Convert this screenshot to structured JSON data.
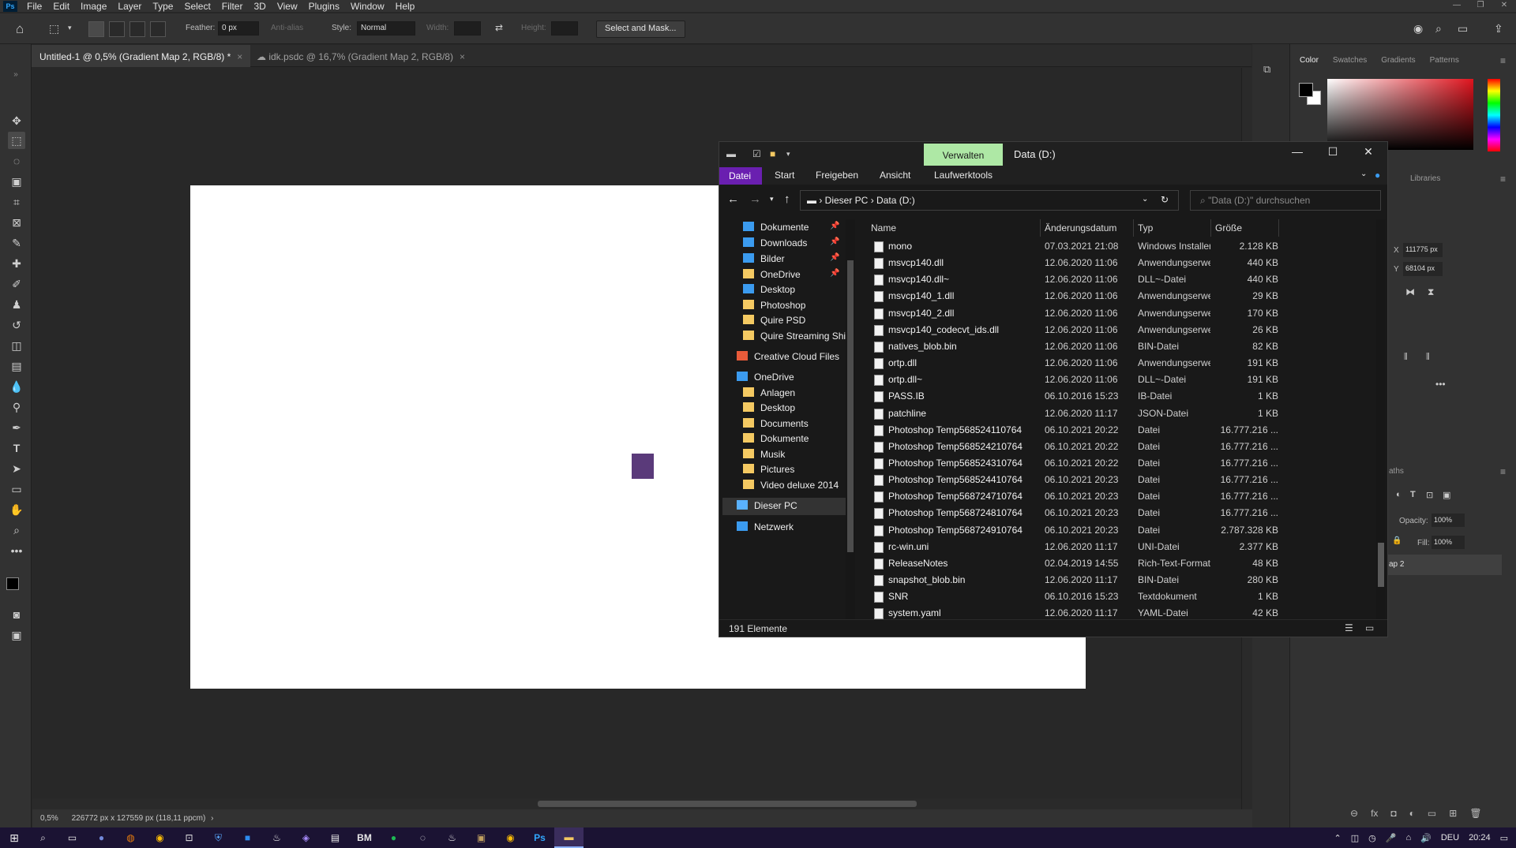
{
  "ps": {
    "menu": [
      "File",
      "Edit",
      "Image",
      "Layer",
      "Type",
      "Select",
      "Filter",
      "3D",
      "View",
      "Plugins",
      "Window",
      "Help"
    ],
    "logo": "Ps",
    "options": {
      "feather_label": "Feather:",
      "feather_value": "0 px",
      "antialias": "Anti-alias",
      "style_label": "Style:",
      "style_value": "Normal",
      "width_label": "Width:",
      "height_label": "Height:",
      "select_mask": "Select and Mask..."
    },
    "tabs": [
      {
        "label": "Untitled-1 @ 0,5% (Gradient Map 2, RGB/8) *"
      },
      {
        "label": "idk.psdc @ 16,7% (Gradient Map 2, RGB/8)"
      }
    ],
    "status": {
      "zoom": "0,5%",
      "doc_size": "226772 px x 127559 px (118,11 ppcm)"
    },
    "panels": {
      "color_tabs": [
        "Color",
        "Swatches",
        "Gradients",
        "Patterns"
      ],
      "libraries_tab": "Libraries",
      "x_label": "X",
      "x_value": "111775 px",
      "y_label": "Y",
      "y_value": "68104 px",
      "opacity_label": "Opacity:",
      "opacity_value": "100%",
      "fill_label": "Fill:",
      "fill_value": "100%",
      "layer_name": "ap 2",
      "paths_tab": "aths"
    }
  },
  "explorer": {
    "manage_tab": "Verwalten",
    "window_title": "Data (D:)",
    "ribbon": [
      "Datei",
      "Start",
      "Freigeben",
      "Ansicht",
      "Laufwerktools"
    ],
    "breadcrumb": [
      "Dieser PC",
      "Data (D:)"
    ],
    "search_placeholder": "\"Data (D:)\" durchsuchen",
    "nav": [
      {
        "label": "Dokumente",
        "pinned": true
      },
      {
        "label": "Downloads",
        "pinned": true
      },
      {
        "label": "Bilder",
        "pinned": true
      },
      {
        "label": "OneDrive",
        "pinned": true
      },
      {
        "label": "Desktop"
      },
      {
        "label": "Photoshop"
      },
      {
        "label": "Quire PSD"
      },
      {
        "label": "Quire Streaming Shi"
      },
      {
        "label": "Creative Cloud Files"
      },
      {
        "label": "OneDrive"
      },
      {
        "label": "Anlagen"
      },
      {
        "label": "Desktop"
      },
      {
        "label": "Documents"
      },
      {
        "label": "Dokumente"
      },
      {
        "label": "Musik"
      },
      {
        "label": "Pictures"
      },
      {
        "label": "Video deluxe 2014"
      },
      {
        "label": "Dieser PC"
      },
      {
        "label": "Netzwerk"
      }
    ],
    "columns": [
      "Name",
      "Änderungsdatum",
      "Typ",
      "Größe"
    ],
    "files": [
      {
        "name": "mono",
        "date": "07.03.2021 21:08",
        "type": "Windows Installer...",
        "size": "2.128 KB"
      },
      {
        "name": "msvcp140.dll",
        "date": "12.06.2020 11:06",
        "type": "Anwendungserwe...",
        "size": "440 KB"
      },
      {
        "name": "msvcp140.dll~",
        "date": "12.06.2020 11:06",
        "type": "DLL~-Datei",
        "size": "440 KB"
      },
      {
        "name": "msvcp140_1.dll",
        "date": "12.06.2020 11:06",
        "type": "Anwendungserwe...",
        "size": "29 KB"
      },
      {
        "name": "msvcp140_2.dll",
        "date": "12.06.2020 11:06",
        "type": "Anwendungserwe...",
        "size": "170 KB"
      },
      {
        "name": "msvcp140_codecvt_ids.dll",
        "date": "12.06.2020 11:06",
        "type": "Anwendungserwe...",
        "size": "26 KB"
      },
      {
        "name": "natives_blob.bin",
        "date": "12.06.2020 11:06",
        "type": "BIN-Datei",
        "size": "82 KB"
      },
      {
        "name": "ortp.dll",
        "date": "12.06.2020 11:06",
        "type": "Anwendungserwe...",
        "size": "191 KB"
      },
      {
        "name": "ortp.dll~",
        "date": "12.06.2020 11:06",
        "type": "DLL~-Datei",
        "size": "191 KB"
      },
      {
        "name": "PASS.IB",
        "date": "06.10.2016 15:23",
        "type": "IB-Datei",
        "size": "1 KB"
      },
      {
        "name": "patchline",
        "date": "12.06.2020 11:17",
        "type": "JSON-Datei",
        "size": "1 KB"
      },
      {
        "name": "Photoshop Temp568524110764",
        "date": "06.10.2021 20:22",
        "type": "Datei",
        "size": "16.777.216 ..."
      },
      {
        "name": "Photoshop Temp568524210764",
        "date": "06.10.2021 20:22",
        "type": "Datei",
        "size": "16.777.216 ..."
      },
      {
        "name": "Photoshop Temp568524310764",
        "date": "06.10.2021 20:22",
        "type": "Datei",
        "size": "16.777.216 ..."
      },
      {
        "name": "Photoshop Temp568524410764",
        "date": "06.10.2021 20:23",
        "type": "Datei",
        "size": "16.777.216 ..."
      },
      {
        "name": "Photoshop Temp568724710764",
        "date": "06.10.2021 20:23",
        "type": "Datei",
        "size": "16.777.216 ..."
      },
      {
        "name": "Photoshop Temp568724810764",
        "date": "06.10.2021 20:23",
        "type": "Datei",
        "size": "16.777.216 ..."
      },
      {
        "name": "Photoshop Temp568724910764",
        "date": "06.10.2021 20:23",
        "type": "Datei",
        "size": "2.787.328 KB"
      },
      {
        "name": "rc-win.uni",
        "date": "12.06.2020 11:17",
        "type": "UNI-Datei",
        "size": "2.377 KB"
      },
      {
        "name": "ReleaseNotes",
        "date": "02.04.2019 14:55",
        "type": "Rich-Text-Format",
        "size": "48 KB"
      },
      {
        "name": "snapshot_blob.bin",
        "date": "12.06.2020 11:17",
        "type": "BIN-Datei",
        "size": "280 KB"
      },
      {
        "name": "SNR",
        "date": "06.10.2016 15:23",
        "type": "Textdokument",
        "size": "1 KB"
      },
      {
        "name": "system.yaml",
        "date": "12.06.2020 11:17",
        "type": "YAML-Datei",
        "size": "42 KB"
      }
    ],
    "status": "191 Elemente"
  },
  "taskbar": {
    "items": [
      "Search",
      "Task View",
      "Discord",
      "Blender",
      "Chrome",
      "Screenshot",
      "Security",
      "FL",
      "Steam",
      "App",
      "Folder",
      "BM",
      "Spotify",
      "OBS",
      "Steam2",
      "Epic",
      "Chrome2",
      "Photoshop",
      "Explorer"
    ],
    "lang": "DEU",
    "time": "20:24"
  },
  "colors": {
    "accent_purple": "#6a1fb0",
    "manage_green": "#aee8a5"
  }
}
